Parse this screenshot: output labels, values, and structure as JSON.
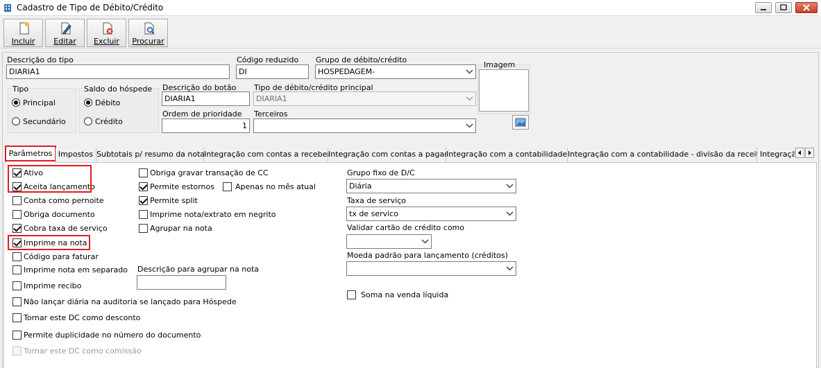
{
  "window": {
    "title": "Cadastro de Tipo de Débito/Crédito"
  },
  "toolbar": {
    "incluir": "Incluir",
    "editar": "Editar",
    "excluir": "Excluir",
    "procurar": "Procurar"
  },
  "form": {
    "descricao_label": "Descrição do tipo",
    "descricao_value": "DIARIA1",
    "codigo_label": "Código reduzido",
    "codigo_value": "DI",
    "grupo_label": "Grupo de débito/crédito",
    "grupo_value": "HOSPEDAGEM-",
    "imagem_label": "Imagem",
    "tipo_label": "Tipo",
    "tipo_principal": "Principal",
    "tipo_secundario": "Secundário",
    "saldo_label": "Saldo do hóspede",
    "saldo_debito": "Débito",
    "saldo_credito": "Crédito",
    "botao_label": "Descrição do botão",
    "botao_value": "DIARIA1",
    "tipo_principal_dc_label": "Tipo de débito/crédito principal",
    "tipo_principal_dc_value": "DIARIA1",
    "ordem_label": "Ordem de prioridade",
    "ordem_value": "1",
    "terceiros_label": "Terceiros",
    "terceiros_value": ""
  },
  "tabs": [
    "Parâmetros",
    "Impostos",
    "Subtotais p/ resumo da nota",
    "Integração com contas a receber",
    "Integração com contas a pagar",
    "Integração com a contabilidade",
    "Integração com a contabilidade - divisão da receita",
    "Integraçã"
  ],
  "params": {
    "ativo": "Ativo",
    "aceita": "Aceita lançamento",
    "pernoite": "Conta como pernoite",
    "obriga_doc": "Obriga documento",
    "cobra_taxa": "Cobra taxa de serviço",
    "imprime_nota": "Imprime na nota",
    "codigo_faturar": "Código para faturar",
    "imprime_separado": "Imprime nota em separado",
    "imprime_recibo": "Imprime recibo",
    "nao_lancar": "Não lançar diária na auditoria se lançado para Hóspede",
    "desconto": "Tornar este DC como desconto",
    "duplicidade": "Permite duplicidade no número do documento",
    "comissao": "Tornar este DC como comissão",
    "obriga_cc": "Obriga gravar transação de CC",
    "estornos": "Permite estornos",
    "mes_atual": "Apenas no mês atual",
    "split": "Permite split",
    "negrito": "Imprime nota/extrato em negrito",
    "agrupar": "Agrupar na nota",
    "desc_agrupar_label": "Descrição para agrupar na nota",
    "desc_agrupar_value": "",
    "grupo_fixo_label": "Grupo fixo de D/C",
    "grupo_fixo_value": "Diária",
    "taxa_label": "Taxa de serviço",
    "taxa_value": "tx de servico",
    "validar_label": "Validar cartão de crédito como",
    "validar_value": "",
    "moeda_label": "Moeda padrão para lançamento (créditos)",
    "moeda_value": "",
    "soma": "Soma na venda líquida"
  }
}
